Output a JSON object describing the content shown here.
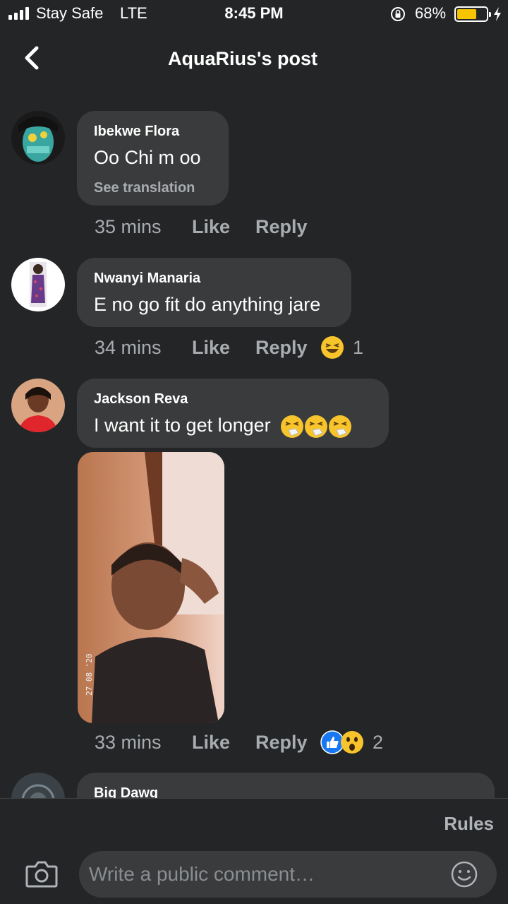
{
  "status_bar": {
    "carrier": "Stay Safe",
    "network": "LTE",
    "time": "8:45 PM",
    "battery_percent": "68%",
    "battery_level": 0.68,
    "icons": [
      "signal-icon",
      "rotation-lock-icon",
      "battery-icon",
      "charging-icon"
    ]
  },
  "header": {
    "title": "AquaRius's post",
    "back_icon": "chevron-left-icon"
  },
  "comments": [
    {
      "author": "Ibekwe Flora",
      "text": "Oo Chi m oo",
      "see_translation": "See translation",
      "time": "35 mins",
      "like": "Like",
      "reply": "Reply"
    },
    {
      "author": "Nwanyi Manaria",
      "text": "E no go fit do anything jare",
      "time": "34 mins",
      "like": "Like",
      "reply": "Reply",
      "reactions": [
        "laughing-emoji"
      ],
      "reaction_count": "1"
    },
    {
      "author": "Jackson Reva",
      "text": "I want it to get longer",
      "text_emojis": [
        "sneezing-face-emoji",
        "sneezing-face-emoji",
        "sneezing-face-emoji"
      ],
      "photo_stamp": "27 08 '20",
      "time": "33 mins",
      "like": "Like",
      "reply": "Reply",
      "reactions": [
        "like-reaction",
        "wow-reaction"
      ],
      "reaction_count": "2"
    },
    {
      "author": "Big Dawg"
    }
  ],
  "footer": {
    "rules": "Rules",
    "placeholder": "Write a public comment…",
    "camera_icon": "camera-icon",
    "emoji_icon": "smiley-icon"
  },
  "colors": {
    "background": "#242526",
    "bubble": "#3a3b3c",
    "secondary_text": "#a8abaf",
    "battery": "#f8c400",
    "like_blue": "#1877f2"
  }
}
